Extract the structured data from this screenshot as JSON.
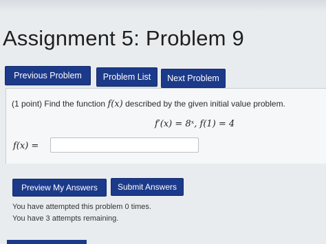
{
  "page_title": "Assignment 5: Problem 9",
  "nav": {
    "previous_label": "Previous Problem",
    "list_label": "Problem List",
    "next_label": "Next Problem"
  },
  "problem": {
    "points": "(1 point)",
    "prompt_before": "Find the function",
    "function_symbol": "f(x)",
    "prompt_after": "described by the given initial value problem.",
    "equation": "f′(x) = 8ˣ,    f(1) = 4",
    "answer_label": "f(x) =",
    "answer_value": ""
  },
  "actions": {
    "preview_label": "Preview My Answers",
    "submit_label": "Submit Answers"
  },
  "status": {
    "attempted": "You have attempted this problem 0 times.",
    "remaining": "You have 3 attempts remaining."
  },
  "colors": {
    "button_bg": "#1c3a8a",
    "page_bg": "#e9ecef"
  }
}
